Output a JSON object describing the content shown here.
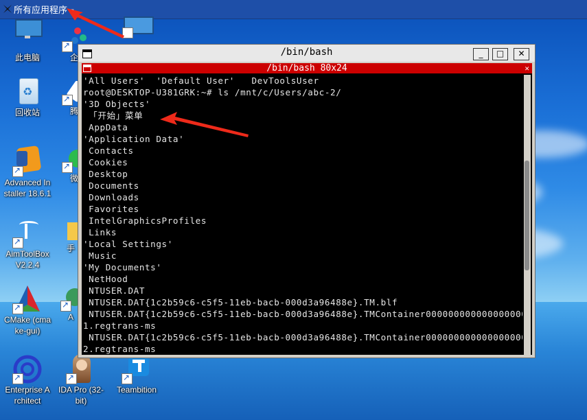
{
  "colors": {
    "topbar": "#1e4fa8",
    "terminal_title": "#cc0000",
    "terminal_bg": "#000000",
    "terminal_fg": "#e6e6e6",
    "annotation_arrow": "#ee2a1a"
  },
  "topbar": {
    "menu_icon": "app-menu-icon",
    "menu_label": "所有应用程序",
    "menu_suffix": "≡"
  },
  "desktop_icons": [
    {
      "name": "此电脑",
      "icon": "computer-icon"
    },
    {
      "name": "企",
      "icon": "app-icon"
    },
    {
      "name": "回收站",
      "icon": "recycle-bin-icon"
    },
    {
      "name": "腾",
      "icon": "app-icon"
    },
    {
      "name": "Advanced Installer 18.6.1",
      "icon": "installer-icon",
      "l1": "Advanced In",
      "l2": "staller 18.6.1"
    },
    {
      "name": "微",
      "icon": "wechat-icon"
    },
    {
      "name": "AimToolBox V2.2.4",
      "icon": "aim-icon",
      "l1": "AimToolBox",
      "l2": "V2.2.4"
    },
    {
      "name": "手",
      "icon": "folder-icon"
    },
    {
      "name": "CMake (cmake-gui)",
      "icon": "cmake-icon",
      "l1": "CMake (cma",
      "l2": "ke-gui)"
    },
    {
      "name": "A",
      "icon": "app-icon"
    },
    {
      "name": "Enterprise Architect",
      "icon": "enterprise-architect-icon",
      "l1": "Enterprise A",
      "l2": "rchitect"
    },
    {
      "name": "IDA Pro (32-bit)",
      "icon": "ida-icon",
      "l1": "IDA Pro (32-",
      "l2": "bit)"
    },
    {
      "name": "Teambition",
      "icon": "teambition-icon"
    }
  ],
  "window": {
    "title": "/bin/bash",
    "buttons": {
      "minimize": "_",
      "maximize": "□",
      "close": "✕"
    },
    "inner_title": "/bin/bash 80x24",
    "inner_close": "✕",
    "lines": [
      "'All Users'  'Default User'   DevToolsUser",
      "root@DESKTOP-U381GRK:~# ls /mnt/c/Users/abc-2/",
      "'3D Objects'",
      " 「开始」菜单",
      " AppData",
      "'Application Data'",
      " Contacts",
      " Cookies",
      " Desktop",
      " Documents",
      " Downloads",
      " Favorites",
      " IntelGraphicsProfiles",
      " Links",
      "'Local Settings'",
      " Music",
      "'My Documents'",
      " NetHood",
      " NTUSER.DAT",
      " NTUSER.DAT{1c2b59c6-c5f5-11eb-bacb-000d3a96488e}.TM.blf",
      " NTUSER.DAT{1c2b59c6-c5f5-11eb-bacb-000d3a96488e}.TMContainer0000000000000000000",
      "1.regtrans-ms",
      " NTUSER.DAT{1c2b59c6-c5f5-11eb-bacb-000d3a96488e}.TMContainer0000000000000000000",
      "2.regtrans-ms"
    ]
  }
}
